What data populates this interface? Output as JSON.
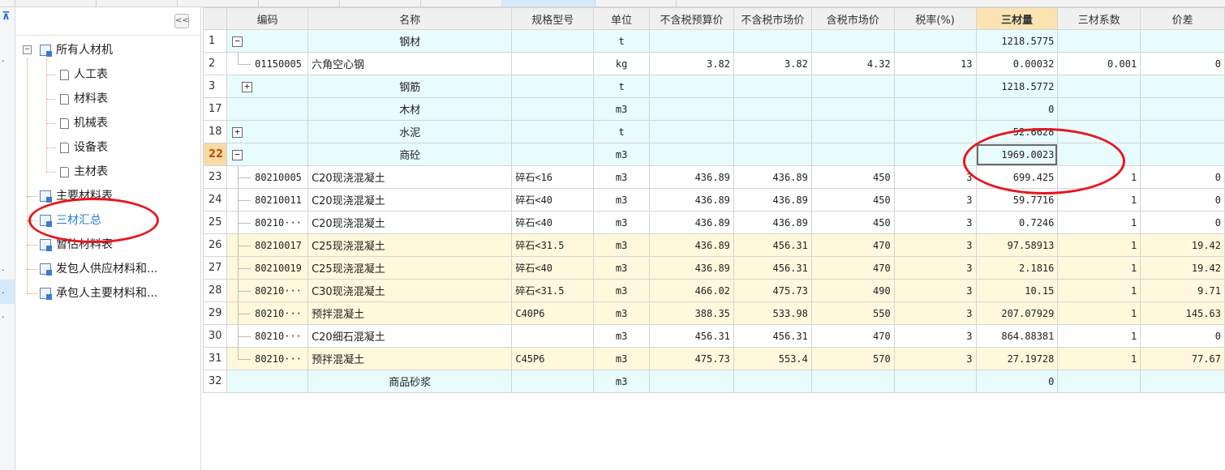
{
  "colors": {
    "accent_blue": "#2a7fdc",
    "annotation_red": "#e8161e",
    "header_highlight": "#fbe4b2",
    "group_row": "#e8fbfd",
    "diff_row": "#fff8dc"
  },
  "left_nav": {
    "glyph_top": "⊼",
    "dots": [
      "·",
      "·",
      "·",
      "·"
    ]
  },
  "tree": {
    "collapse_label": "<<",
    "root": {
      "toggle": "−",
      "label": "所有人材机"
    },
    "children": [
      "人工表",
      "材料表",
      "机械表",
      "设备表",
      "主材表"
    ],
    "items": [
      "主要材料表",
      "三材汇总",
      "暂估材料表",
      "发包人供应材料和...",
      "承包人主要材料和..."
    ],
    "selected": "三材汇总"
  },
  "table": {
    "columns": [
      "",
      "编码",
      "名称",
      "规格型号",
      "单位",
      "不含税预算价",
      "不含税市场价",
      "含税市场价",
      "税率(%)",
      "三材量",
      "三材系数",
      "价差"
    ],
    "highlight_column": "三材量",
    "rows": [
      {
        "no": "1",
        "toggle": "−",
        "code": "",
        "name": "钢材",
        "spec": "",
        "unit": "t",
        "budget": "",
        "market": "",
        "tax_market": "",
        "tax_rate": "",
        "qty": "1218.5775",
        "coef": "",
        "diff": ""
      },
      {
        "no": "2",
        "toggle": "",
        "code": "01150005",
        "name": "六角空心钢",
        "spec": "",
        "unit": "kg",
        "budget": "3.82",
        "market": "3.82",
        "tax_market": "4.32",
        "tax_rate": "13",
        "qty": "0.00032",
        "coef": "0.001",
        "diff": "0"
      },
      {
        "no": "3",
        "toggle": "+",
        "code": "",
        "name": "钢筋",
        "spec": "",
        "unit": "t",
        "budget": "",
        "market": "",
        "tax_market": "",
        "tax_rate": "",
        "qty": "1218.5772",
        "coef": "",
        "diff": ""
      },
      {
        "no": "17",
        "toggle": "",
        "code": "",
        "name": "木材",
        "spec": "",
        "unit": "m3",
        "budget": "",
        "market": "",
        "tax_market": "",
        "tax_rate": "",
        "qty": "0",
        "coef": "",
        "diff": ""
      },
      {
        "no": "18",
        "toggle": "+",
        "code": "",
        "name": "水泥",
        "spec": "",
        "unit": "t",
        "budget": "",
        "market": "",
        "tax_market": "",
        "tax_rate": "",
        "qty": "52.6628",
        "coef": "",
        "diff": ""
      },
      {
        "no": "22",
        "toggle": "−",
        "code": "",
        "name": "商砼",
        "spec": "",
        "unit": "m3",
        "budget": "",
        "market": "",
        "tax_market": "",
        "tax_rate": "",
        "qty": "1969.0023",
        "coef": "",
        "diff": ""
      },
      {
        "no": "23",
        "toggle": "",
        "code": "80210005",
        "name": "C20现浇混凝土",
        "spec": "碎石<16",
        "unit": "m3",
        "budget": "436.89",
        "market": "436.89",
        "tax_market": "450",
        "tax_rate": "3",
        "qty": "699.425",
        "coef": "1",
        "diff": "0"
      },
      {
        "no": "24",
        "toggle": "",
        "code": "80210011",
        "name": "C20现浇混凝土",
        "spec": "碎石<40",
        "unit": "m3",
        "budget": "436.89",
        "market": "436.89",
        "tax_market": "450",
        "tax_rate": "3",
        "qty": "59.7716",
        "coef": "1",
        "diff": "0"
      },
      {
        "no": "25",
        "toggle": "",
        "code": "80210···",
        "name": "C20现浇混凝土",
        "spec": "碎石<40",
        "unit": "m3",
        "budget": "436.89",
        "market": "436.89",
        "tax_market": "450",
        "tax_rate": "3",
        "qty": "0.7246",
        "coef": "1",
        "diff": "0"
      },
      {
        "no": "26",
        "toggle": "",
        "code": "80210017",
        "name": "C25现浇混凝土",
        "spec": "碎石<31.5",
        "unit": "m3",
        "budget": "436.89",
        "market": "456.31",
        "tax_market": "470",
        "tax_rate": "3",
        "qty": "97.58913",
        "coef": "1",
        "diff": "19.42"
      },
      {
        "no": "27",
        "toggle": "",
        "code": "80210019",
        "name": "C25现浇混凝土",
        "spec": "碎石<40",
        "unit": "m3",
        "budget": "436.89",
        "market": "456.31",
        "tax_market": "470",
        "tax_rate": "3",
        "qty": "2.1816",
        "coef": "1",
        "diff": "19.42"
      },
      {
        "no": "28",
        "toggle": "",
        "code": "80210···",
        "name": "C30现浇混凝土",
        "spec": "碎石<31.5",
        "unit": "m3",
        "budget": "466.02",
        "market": "475.73",
        "tax_market": "490",
        "tax_rate": "3",
        "qty": "10.15",
        "coef": "1",
        "diff": "9.71"
      },
      {
        "no": "29",
        "toggle": "",
        "code": "80210···",
        "name": "预拌混凝土",
        "spec": "C40P6",
        "unit": "m3",
        "budget": "388.35",
        "market": "533.98",
        "tax_market": "550",
        "tax_rate": "3",
        "qty": "207.07929",
        "coef": "1",
        "diff": "145.63"
      },
      {
        "no": "30",
        "toggle": "",
        "code": "80210···",
        "name": "C20细石混凝土",
        "spec": "",
        "unit": "m3",
        "budget": "456.31",
        "market": "456.31",
        "tax_market": "470",
        "tax_rate": "3",
        "qty": "864.88381",
        "coef": "1",
        "diff": "0"
      },
      {
        "no": "31",
        "toggle": "",
        "code": "80210···",
        "name": "预拌混凝土",
        "spec": "C45P6",
        "unit": "m3",
        "budget": "475.73",
        "market": "553.4",
        "tax_market": "570",
        "tax_rate": "3",
        "qty": "27.19728",
        "coef": "1",
        "diff": "77.67"
      },
      {
        "no": "32",
        "toggle": "",
        "code": "",
        "name": "商品砂浆",
        "spec": "",
        "unit": "m3",
        "budget": "",
        "market": "",
        "tax_market": "",
        "tax_rate": "",
        "qty": "0",
        "coef": "",
        "diff": ""
      }
    ]
  }
}
